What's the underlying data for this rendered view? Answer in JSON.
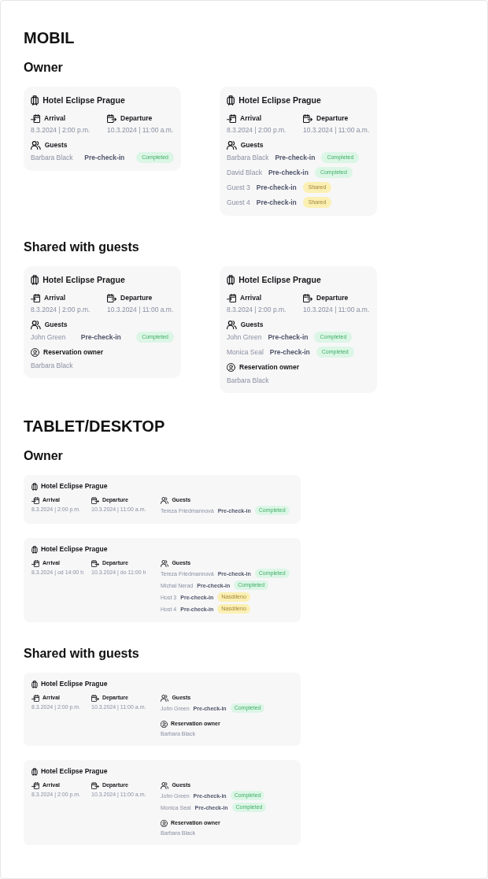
{
  "sections": [
    {
      "kind": "mobile",
      "title": "MOBIL",
      "groups": [
        {
          "title": "Owner",
          "cards": [
            {
              "hotel": "Hotel Eclipse Prague",
              "arrival": {
                "label": "Arrival",
                "value": "8.3.2024 | 2:00 p.m."
              },
              "departure": {
                "label": "Departure",
                "value": "10.3.2024 | 11:00 a.m."
              },
              "guests": {
                "label": "Guests",
                "rows": [
                  {
                    "name": "Barbara Black",
                    "action": "Pre-check-in",
                    "status": {
                      "kind": "completed",
                      "text": "Completed"
                    }
                  }
                ]
              }
            },
            {
              "hotel": "Hotel Eclipse Prague",
              "arrival": {
                "label": "Arrival",
                "value": "8.3.2024 | 2:00 p.m."
              },
              "departure": {
                "label": "Departure",
                "value": "10.3.2024 | 11:00 a.m."
              },
              "guests": {
                "label": "Guests",
                "rows": [
                  {
                    "name": "Barbara Black",
                    "action": "Pre-check-in",
                    "status": {
                      "kind": "completed",
                      "text": "Completed"
                    }
                  },
                  {
                    "name": "David Black",
                    "action": "Pre-check-in",
                    "status": {
                      "kind": "completed",
                      "text": "Completed"
                    }
                  },
                  {
                    "name": "Guest 3",
                    "action": "Pre-check-in",
                    "status": {
                      "kind": "shared",
                      "text": "Shared"
                    }
                  },
                  {
                    "name": "Guest 4",
                    "action": "Pre-check-in",
                    "status": {
                      "kind": "shared",
                      "text": "Shared"
                    }
                  }
                ]
              }
            }
          ]
        },
        {
          "title": "Shared with guests",
          "cards": [
            {
              "hotel": "Hotel Eclipse Prague",
              "arrival": {
                "label": "Arrival",
                "value": "8.3.2024 | 2:00 p.m."
              },
              "departure": {
                "label": "Departure",
                "value": "10.3.2024 | 11:00 a.m."
              },
              "guests": {
                "label": "Guests",
                "rows": [
                  {
                    "name": "John Green",
                    "action": "Pre-check-in",
                    "status": {
                      "kind": "completed",
                      "text": "Completed"
                    }
                  }
                ]
              },
              "owner": {
                "label": "Reservation owner",
                "name": "Barbara Black"
              }
            },
            {
              "hotel": "Hotel Eclipse Prague",
              "arrival": {
                "label": "Arrival",
                "value": "8.3.2024 | 2:00 p.m."
              },
              "departure": {
                "label": "Departure",
                "value": "10.3.2024 | 11:00 a.m."
              },
              "guests": {
                "label": "Guests",
                "rows": [
                  {
                    "name": "John Green",
                    "action": "Pre-check-in",
                    "status": {
                      "kind": "completed",
                      "text": "Completed"
                    }
                  },
                  {
                    "name": "Monica Seal",
                    "action": "Pre-check-in",
                    "status": {
                      "kind": "completed",
                      "text": "Completed"
                    }
                  }
                ]
              },
              "owner": {
                "label": "Reservation owner",
                "name": "Barbara Black"
              }
            }
          ]
        }
      ]
    },
    {
      "kind": "tablet",
      "title": "TABLET/DESKTOP",
      "groups": [
        {
          "title": "Owner",
          "cards": [
            {
              "hotel": "Hotel Eclipse Prague",
              "arrival": {
                "label": "Arrival",
                "value": "8.3.2024 | 2:00 p.m."
              },
              "departure": {
                "label": "Departure",
                "value": "10.3.2024 | 11:00 a.m."
              },
              "guests": {
                "label": "Guests",
                "rows": [
                  {
                    "name": "Tereza Friedmannová",
                    "action": "Pre-check-in",
                    "status": {
                      "kind": "completed",
                      "text": "Completed"
                    }
                  }
                ]
              }
            },
            {
              "hotel": "Hotel Eclipse Prague",
              "arrival": {
                "label": "Arrival",
                "value": "8.3.2024 | od 14:00 h"
              },
              "departure": {
                "label": "Departure",
                "value": "10.3.2024 | do 11:00 h"
              },
              "guests": {
                "label": "Guests",
                "rows": [
                  {
                    "name": "Tereza Friedmannová",
                    "action": "Pre-check-in",
                    "status": {
                      "kind": "completed",
                      "text": "Completed"
                    }
                  },
                  {
                    "name": "Michal Nerad",
                    "action": "Pre-check-in",
                    "status": {
                      "kind": "completed",
                      "text": "Completed"
                    }
                  },
                  {
                    "name": "Host 3",
                    "action": "Pre-check-in",
                    "status": {
                      "kind": "shared",
                      "text": "Nasdíleno"
                    }
                  },
                  {
                    "name": "Host 4",
                    "action": "Pre-check-in",
                    "status": {
                      "kind": "shared",
                      "text": "Nasdíleno"
                    }
                  }
                ]
              }
            }
          ]
        },
        {
          "title": "Shared with guests",
          "cards": [
            {
              "hotel": "Hotel Eclipse Prague",
              "arrival": {
                "label": "Arrival",
                "value": "8.3.2024 | 2:00 p.m."
              },
              "departure": {
                "label": "Departure",
                "value": "10.3.2024 | 11:00 a.m."
              },
              "guests": {
                "label": "Guests",
                "rows": [
                  {
                    "name": "John Green",
                    "action": "Pre-check-in",
                    "status": {
                      "kind": "completed",
                      "text": "Completed"
                    }
                  }
                ]
              },
              "owner": {
                "label": "Reservation owner",
                "name": "Barbara Black"
              }
            },
            {
              "hotel": "Hotel Eclipse Prague",
              "arrival": {
                "label": "Arrival",
                "value": "8.3.2024 | 2:00 p.m."
              },
              "departure": {
                "label": "Departure",
                "value": "10.3.2024 | 11:00 a.m."
              },
              "guests": {
                "label": "Guests",
                "rows": [
                  {
                    "name": "John Green",
                    "action": "Pre-check-in",
                    "status": {
                      "kind": "completed",
                      "text": "Completed"
                    }
                  },
                  {
                    "name": "Monica Seal",
                    "action": "Pre-check-in",
                    "status": {
                      "kind": "completed",
                      "text": "Completed"
                    }
                  }
                ]
              },
              "owner": {
                "label": "Reservation owner",
                "name": "Barbara Black"
              }
            }
          ]
        }
      ]
    }
  ]
}
